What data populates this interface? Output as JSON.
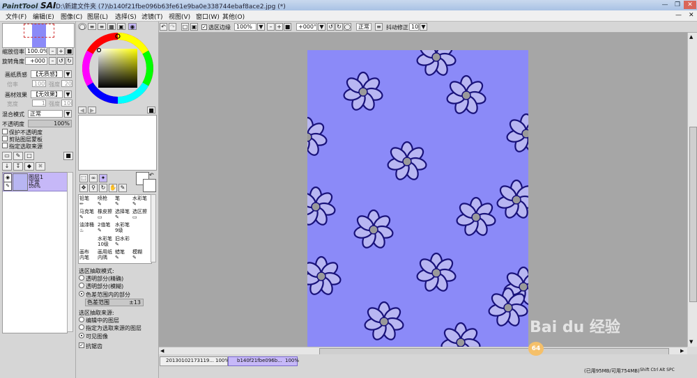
{
  "app": {
    "logo_text": "PaintTool",
    "logo_sai": "SAI",
    "title": "D:\\新建文件夹 (7)\\b140f21fbe096b63fe61e9ba0e338744ebaf8ace2.jpg (*)"
  },
  "menu": [
    "文件(F)",
    "编辑(E)",
    "图像(C)",
    "图层(L)",
    "选择(S)",
    "滤镜(T)",
    "视图(V)",
    "窗口(W)",
    "其他(O)"
  ],
  "nav": {
    "zoom_label": "缩放倍率",
    "zoom_value": "100.0%",
    "rotate_label": "旋转角度",
    "rotate_value": "+000"
  },
  "texture": {
    "paper_label": "画纸质感",
    "paper_value": "【无质感】",
    "scale_label": "倍率",
    "scale_value": "100%",
    "strength_label": "强度",
    "strength_value": "20",
    "effect_label": "画材效果",
    "effect_value": "【无效果】",
    "width_label": "宽度",
    "width_value": "1",
    "effect_strength_label": "强度",
    "effect_strength_value": "100"
  },
  "layer_props": {
    "blend_label": "混合模式",
    "blend_value": "正常",
    "opacity_label": "不透明度",
    "opacity_value": "100%",
    "opts": [
      "保护不透明度",
      "剪贴图层蒙板",
      "指定选取来源"
    ]
  },
  "layers": [
    {
      "name": "图层1",
      "mode": "正常",
      "opacity": "100%"
    }
  ],
  "tools": {
    "row1": [
      "铅笔",
      "喷枪",
      "笔",
      "水彩笔"
    ],
    "row2": [
      "马克笔",
      "橡皮擦",
      "选择笔",
      "选区擦"
    ],
    "row3": [
      "油漆桶",
      "2值笔",
      "水彩笔",
      ""
    ],
    "row3_sub": [
      "",
      "",
      "9级",
      ""
    ],
    "row4": [
      "",
      "水彩笔",
      "旧水彩",
      ""
    ],
    "row4_sub": [
      "",
      "10级",
      "",
      ""
    ],
    "row5": [
      "画布",
      "画用纸",
      "蜡笔",
      "模糊"
    ],
    "row5_sub": [
      "内笔",
      "内隅",
      "",
      ""
    ]
  },
  "select_opts": {
    "mode_label": "选区抽取模式:",
    "modes": [
      "透明部分(精确)",
      "透明部分(模糊)",
      "色差范围内的部分"
    ],
    "range_label": "色差范围",
    "range_value": "±13",
    "source_label": "选区抽取来源:",
    "sources": [
      "编辑中的图层",
      "指定为选取来源的图层",
      "可见图像"
    ],
    "antialias_label": "抗锯齿"
  },
  "toolbar": {
    "selection_edge": "选区边缘",
    "zoom": "100%",
    "angle": "+000°",
    "mode": "正常",
    "stabilizer_label": "抖动修正",
    "stabilizer_value": "10"
  },
  "tabs": [
    {
      "name": "20130102173119...",
      "zoom": "100%"
    },
    {
      "name": "b140f21fbe096b...",
      "zoom": "100%"
    }
  ],
  "status": {
    "memory": "(已用95MB/可用754MB)",
    "keys": "Shift Ctrl Alt SPC",
    "badge": "64"
  },
  "watermark": "Bai du 经验",
  "colors": {
    "canvas_bg": "#8b8af8",
    "petal": "#b8b6f2",
    "outline": "#19127a",
    "center": "#9a9a9a",
    "accent": "#c6b8f8"
  }
}
